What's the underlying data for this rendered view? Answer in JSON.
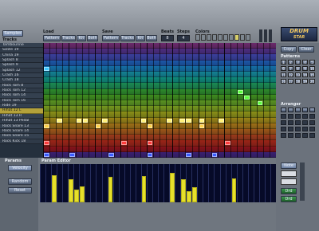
{
  "tabs": {
    "samples": "Samples",
    "tracks": "Tracks"
  },
  "load": {
    "label": "Load",
    "buttons": [
      "Pattern",
      "Tracks",
      "Kit",
      "Both"
    ]
  },
  "save": {
    "label": "Save",
    "buttons": [
      "Pattern",
      "Tracks",
      "Kit",
      "Both"
    ]
  },
  "beats": {
    "label": "Beats",
    "value": "8"
  },
  "steps": {
    "label": "Steps",
    "value": "4"
  },
  "colors": {
    "label": "Colors"
  },
  "logo": {
    "line1": "DRUM",
    "line2": "STAR"
  },
  "track_names": [
    "Tambourine",
    "Sizzle 19",
    "China 19",
    "Splash 8",
    "Splash 9",
    "Splash 12",
    "Crash 16",
    "Crash 18",
    "Rock Tom 8",
    "Rock Tom 12",
    "Rock Tom 14",
    "Rock Tom 16",
    "Ride 19",
    "Hihat 12 L",
    "Hihat 13 R",
    "Hihat 13 Pedal",
    "Rock Snare 13",
    "Rock Snare 14",
    "Rock Snare 15",
    "Rock Kick 18"
  ],
  "selected_track": "Hihat 12 L",
  "row_colors": [
    "#6b2a6b",
    "#4d2e80",
    "#3a3f9c",
    "#1c57a8",
    "#156fa6",
    "#138393",
    "#0f8a7a",
    "#1b8a52",
    "#2d8a2a",
    "#3f8d1d",
    "#5a9320",
    "#76981d",
    "#8b8f16",
    "#9a8316",
    "#9e6f16",
    "#9d5518",
    "#9c3a1a",
    "#9b2416",
    "#87131a",
    "#3a2070"
  ],
  "notes": [
    {
      "row": 4,
      "step": 0,
      "color": "#3fc8ff"
    },
    {
      "row": 8,
      "step": 30,
      "color": "#5cff3e"
    },
    {
      "row": 9,
      "step": 31,
      "color": "#5cff3e"
    },
    {
      "row": 10,
      "step": 33,
      "color": "#5cff3e"
    },
    {
      "row": 13,
      "step": 2,
      "color": "#fff27a"
    },
    {
      "row": 13,
      "step": 5,
      "color": "#fff27a"
    },
    {
      "row": 13,
      "step": 6,
      "color": "#fff27a"
    },
    {
      "row": 13,
      "step": 9,
      "color": "#fff27a"
    },
    {
      "row": 13,
      "step": 15,
      "color": "#fff27a"
    },
    {
      "row": 13,
      "step": 19,
      "color": "#fff27a"
    },
    {
      "row": 13,
      "step": 21,
      "color": "#fff27a"
    },
    {
      "row": 13,
      "step": 22,
      "color": "#fff27a"
    },
    {
      "row": 13,
      "step": 24,
      "color": "#fff27a"
    },
    {
      "row": 13,
      "step": 27,
      "color": "#fff27a"
    },
    {
      "row": 14,
      "step": 0,
      "color": "#ffd24a"
    },
    {
      "row": 14,
      "step": 8,
      "color": "#ffd24a"
    },
    {
      "row": 14,
      "step": 16,
      "color": "#ffd24a"
    },
    {
      "row": 14,
      "step": 24,
      "color": "#ffd24a"
    },
    {
      "row": 17,
      "step": 0,
      "color": "#ff3b3b"
    },
    {
      "row": 17,
      "step": 12,
      "color": "#ff3b3b"
    },
    {
      "row": 17,
      "step": 16,
      "color": "#ff3b3b"
    },
    {
      "row": 17,
      "step": 28,
      "color": "#ff3b3b"
    },
    {
      "row": 19,
      "step": 0,
      "color": "#3b5cff"
    },
    {
      "row": 19,
      "step": 4,
      "color": "#3b5cff"
    },
    {
      "row": 19,
      "step": 10,
      "color": "#3b5cff"
    },
    {
      "row": 19,
      "step": 16,
      "color": "#3b5cff"
    },
    {
      "row": 19,
      "step": 22,
      "color": "#3b5cff"
    },
    {
      "row": 19,
      "step": 26,
      "color": "#3b5cff"
    }
  ],
  "right": {
    "copy": "Copy",
    "clear": "Clear",
    "patterns": "Patterns",
    "arranger": "Arranger",
    "pattern_cells": [
      "1",
      "2",
      "3",
      "4",
      "5",
      "6",
      "7",
      "8",
      "9",
      "10",
      "11",
      "12",
      "13",
      "14",
      "15",
      "16",
      "17",
      "18",
      "19",
      "20"
    ]
  },
  "params": {
    "label": "Params",
    "velocity": "Velocity",
    "random": "Random",
    "reset": "Reset"
  },
  "param_editor": {
    "label": "Param Editor",
    "bars": [
      0,
      0,
      0.75,
      0,
      0,
      0.62,
      0.34,
      0.44,
      0,
      0,
      0,
      0,
      0.7,
      0,
      0,
      0,
      0,
      0,
      0.72,
      0,
      0,
      0,
      0,
      0.8,
      0,
      0.62,
      0.3,
      0.42,
      0,
      0,
      0,
      0,
      0,
      0,
      0.66,
      0,
      0,
      0,
      0,
      0,
      0,
      0
    ]
  },
  "tools": {
    "mode": "Note",
    "draw": "Drd",
    "drd2": "Drd"
  }
}
